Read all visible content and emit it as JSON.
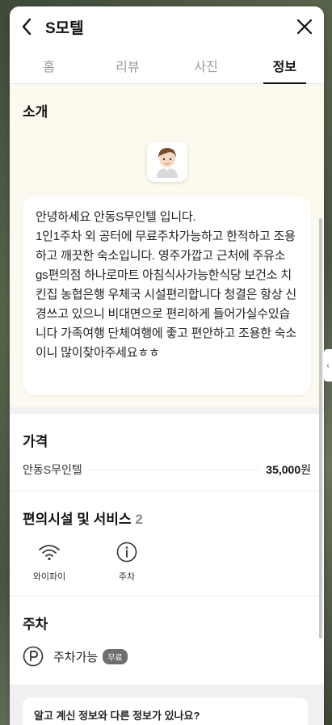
{
  "header": {
    "title": "S모텔"
  },
  "tabs": [
    {
      "label": "홈"
    },
    {
      "label": "리뷰"
    },
    {
      "label": "사진"
    },
    {
      "label": "정보"
    }
  ],
  "intro": {
    "title": "소개",
    "message": "안녕하세요 안동S무인텔 입니다.\n1인1주차 외 공터에 무료주차가능하고 한적하고 조용하고 깨끗한 숙소입니다. 영주가깝고 근처에 주유소 gs편의점 하나로마트 아침식사가능한식당 보건소 치킨집 농협은행 우체국 시설편리합니다 청결은 항상 신경쓰고 있으니 비대면으로 편리하게 들어가실수있습니다 가족여행 단체여행에 좋고 편안하고 조용한 숙소이니 많이찾아주세요ㅎㅎ"
  },
  "price": {
    "title": "가격",
    "name": "안동S무인텔",
    "amount": "35,000",
    "unit": "원"
  },
  "amenities": {
    "title": "편의시설 및 서비스",
    "count": "2",
    "items": [
      {
        "label": "와이파이",
        "icon": "wifi-icon"
      },
      {
        "label": "주차",
        "icon": "info-icon"
      }
    ]
  },
  "parking": {
    "title": "주차",
    "label": "주차가능",
    "badge": "무료",
    "icon": "parking-icon"
  },
  "report": {
    "text": "알고 계신 정보와 다른 정보가 있나요?"
  },
  "colors": {
    "intro_bg": "#fcf9ef",
    "divider": "#f0f0f3",
    "badge_bg": "#6e6e6e"
  }
}
